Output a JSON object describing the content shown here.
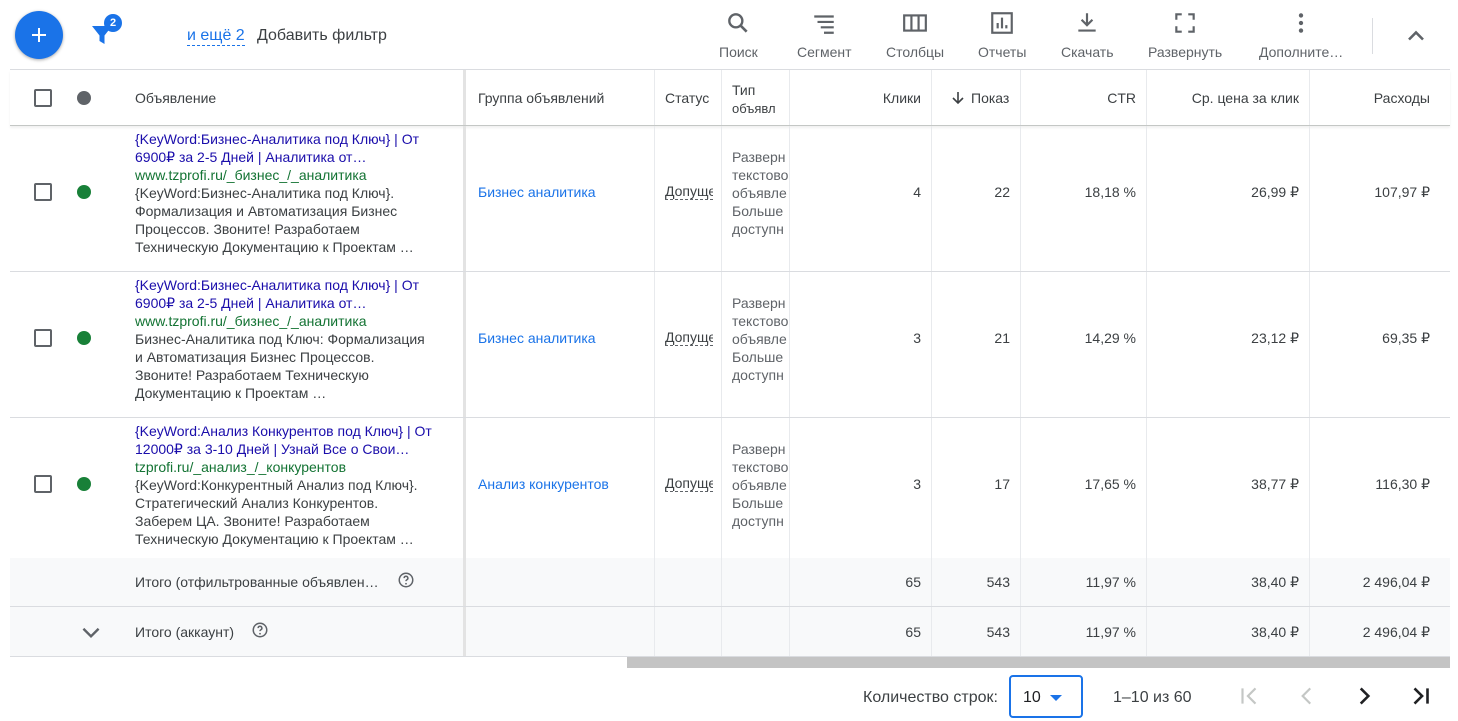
{
  "toolbar": {
    "filter_badge": "2",
    "more_filters": "и ещё 2",
    "add_filter": "Добавить фильтр",
    "tools": [
      {
        "icon": "search-icon",
        "label": "Поиск"
      },
      {
        "icon": "segment-icon",
        "label": "Сегмент"
      },
      {
        "icon": "columns-icon",
        "label": "Столбцы"
      },
      {
        "icon": "reports-icon",
        "label": "Отчеты"
      },
      {
        "icon": "download-icon",
        "label": "Скачать"
      },
      {
        "icon": "expand-icon",
        "label": "Развернуть"
      },
      {
        "icon": "more-vert-icon",
        "label": "Дополните…"
      }
    ]
  },
  "table": {
    "headers": {
      "ad": "Объявление",
      "ad_group": "Группа объявлений",
      "status": "Статус",
      "type_line1": "Тип",
      "type_line2": "объявл",
      "clicks": "Клики",
      "impressions": "Показ",
      "ctr": "CTR",
      "avg_cpc": "Ср. цена за клик",
      "cost": "Расходы"
    },
    "rows": [
      {
        "headline": "{KeyWord:Бизнес-Аналитика под Ключ} | От 6900₽ за 2-5 Дней | Аналитика от…",
        "url": "www.tzprofi.ru/_бизнес_/_аналитика",
        "description": "{KeyWord:Бизнес-Аналитика под Ключ}. Формализация и Автоматизация Бизнес Процессов. Звоните! Разработаем Техническую Документацию к Проектам …",
        "ad_group": "Бизнес аналитика",
        "status": "Допущено",
        "type": [
          "Разверн",
          "текстово",
          "объявле",
          "Больше",
          "доступн"
        ],
        "clicks": "4",
        "impressions": "22",
        "ctr": "18,18 %",
        "avg_cpc": "26,99 ₽",
        "cost": "107,97 ₽",
        "status_color": "#188038"
      },
      {
        "headline": "{KeyWord:Бизнес-Аналитика под Ключ} | От 6900₽ за 2-5 Дней | Аналитика от…",
        "url": "www.tzprofi.ru/_бизнес_/_аналитика",
        "description": "Бизнес-Аналитика под Ключ: Формализация и Автоматизация Бизнес Процессов. Звоните! Разработаем Техническую Документацию к Проектам …",
        "ad_group": "Бизнес аналитика",
        "status": "Допущено",
        "type": [
          "Разверн",
          "текстово",
          "объявле",
          "Больше",
          "доступн"
        ],
        "clicks": "3",
        "impressions": "21",
        "ctr": "14,29 %",
        "avg_cpc": "23,12 ₽",
        "cost": "69,35 ₽",
        "status_color": "#188038"
      },
      {
        "headline": "{KeyWord:Анализ Конкурентов под Ключ} | От 12000₽ за 3-10 Дней | Узнай Все о Свои…",
        "url": "tzprofi.ru/_анализ_/_конкурентов",
        "description": "{KeyWord:Конкурентный Анализ под Ключ}. Стратегический Анализ Конкурентов. Заберем ЦА. Звоните! Разработаем Техническую Документацию к Проектам …",
        "ad_group": "Анализ конкурентов",
        "status": "Допущено",
        "type": [
          "Разверн",
          "текстово",
          "объявле",
          "Больше",
          "доступн"
        ],
        "clicks": "3",
        "impressions": "17",
        "ctr": "17,65 %",
        "avg_cpc": "38,77 ₽",
        "cost": "116,30 ₽",
        "status_color": "#188038"
      }
    ],
    "totals": [
      {
        "label": "Итого (отфильтрованные объявлен…",
        "clicks": "65",
        "impressions": "543",
        "ctr": "11,97 %",
        "avg_cpc": "38,40 ₽",
        "cost": "2 496,04 ₽"
      },
      {
        "label": "Итого (аккаунт)",
        "clicks": "65",
        "impressions": "543",
        "ctr": "11,97 %",
        "avg_cpc": "38,40 ₽",
        "cost": "2 496,04 ₽"
      }
    ]
  },
  "footer": {
    "rows_label": "Количество строк:",
    "rows_value": "10",
    "range": "1–10 из 60"
  },
  "colors": {
    "accent": "#1a73e8",
    "status_eligible": "#188038",
    "headline": "#1a0dab",
    "url": "#137333"
  }
}
